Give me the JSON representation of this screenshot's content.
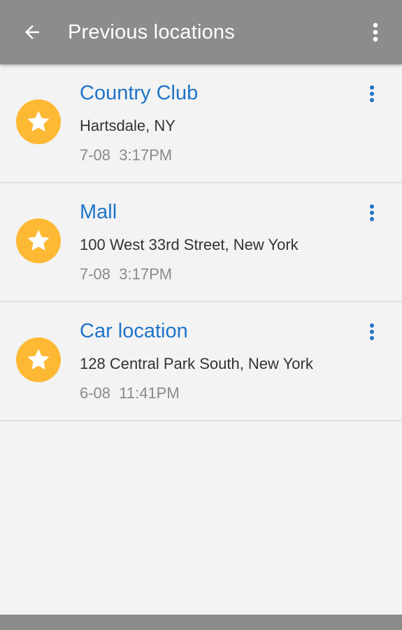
{
  "appbar": {
    "title": "Previous locations",
    "back_icon": "arrow-left-icon",
    "more_icon": "more-vert-icon",
    "background": "#8c8c8c"
  },
  "colors": {
    "title_blue": "#1f74c8",
    "star_badge": "#fdb934",
    "background": "#f3f3f3"
  },
  "locations": [
    {
      "title": "Country Club",
      "address": "Hartsdale, NY",
      "time": "7-08  3:17PM",
      "icon": "star-icon"
    },
    {
      "title": "Mall",
      "address": "100 West 33rd Street, New York",
      "time": "7-08  3:17PM",
      "icon": "star-icon"
    },
    {
      "title": "Car location",
      "address": "128 Central Park South, New York",
      "time": "6-08  11:41PM",
      "icon": "star-icon"
    }
  ]
}
